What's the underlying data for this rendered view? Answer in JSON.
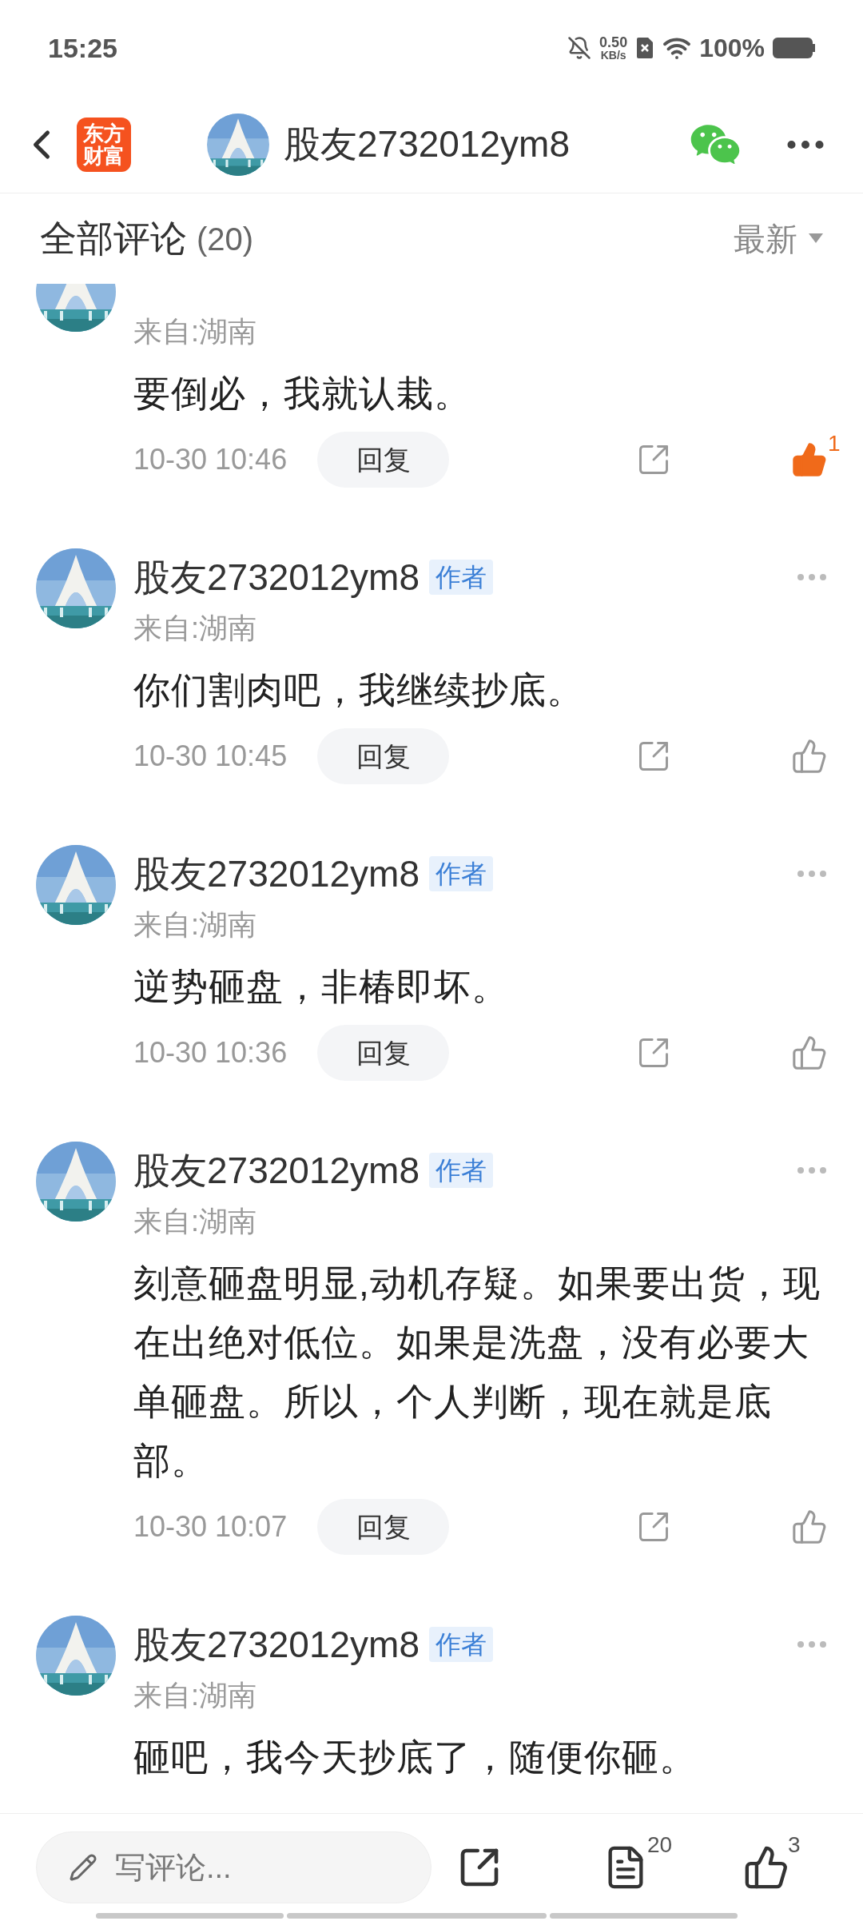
{
  "status_bar": {
    "time": "15:25",
    "speed_value": "0.50",
    "speed_unit": "KB/s",
    "battery": "100%"
  },
  "header": {
    "logo": "东方财富",
    "title": "股友2732012ym8"
  },
  "section": {
    "title": "全部评论",
    "count": "(20)",
    "sort": "最新"
  },
  "comments": [
    {
      "location": "来自:湖南",
      "text": "要倒必，我就认栽。",
      "time": "10-30 10:46",
      "reply": "回复",
      "liked": true,
      "like_count": "1"
    },
    {
      "name": "股友2732012ym8",
      "badge": "作者",
      "location": "来自:湖南",
      "text": "你们割肉吧，我继续抄底。",
      "time": "10-30 10:45",
      "reply": "回复",
      "liked": false
    },
    {
      "name": "股友2732012ym8",
      "badge": "作者",
      "location": "来自:湖南",
      "text": "逆势砸盘，非椿即坏。",
      "time": "10-30 10:36",
      "reply": "回复",
      "liked": false
    },
    {
      "name": "股友2732012ym8",
      "badge": "作者",
      "location": "来自:湖南",
      "text": "刻意砸盘明显,动机存疑。如果要出货，现在出绝对低位。如果是洗盘，没有必要大单砸盘。所以，个人判断，现在就是底部。",
      "time": "10-30 10:07",
      "reply": "回复",
      "liked": false
    },
    {
      "name": "股友2732012ym8",
      "badge": "作者",
      "location": "来自:湖南",
      "text": "砸吧，我今天抄底了，随便你砸。"
    }
  ],
  "bottom_bar": {
    "placeholder": "写评论...",
    "comment_count": "20",
    "like_count": "3"
  }
}
